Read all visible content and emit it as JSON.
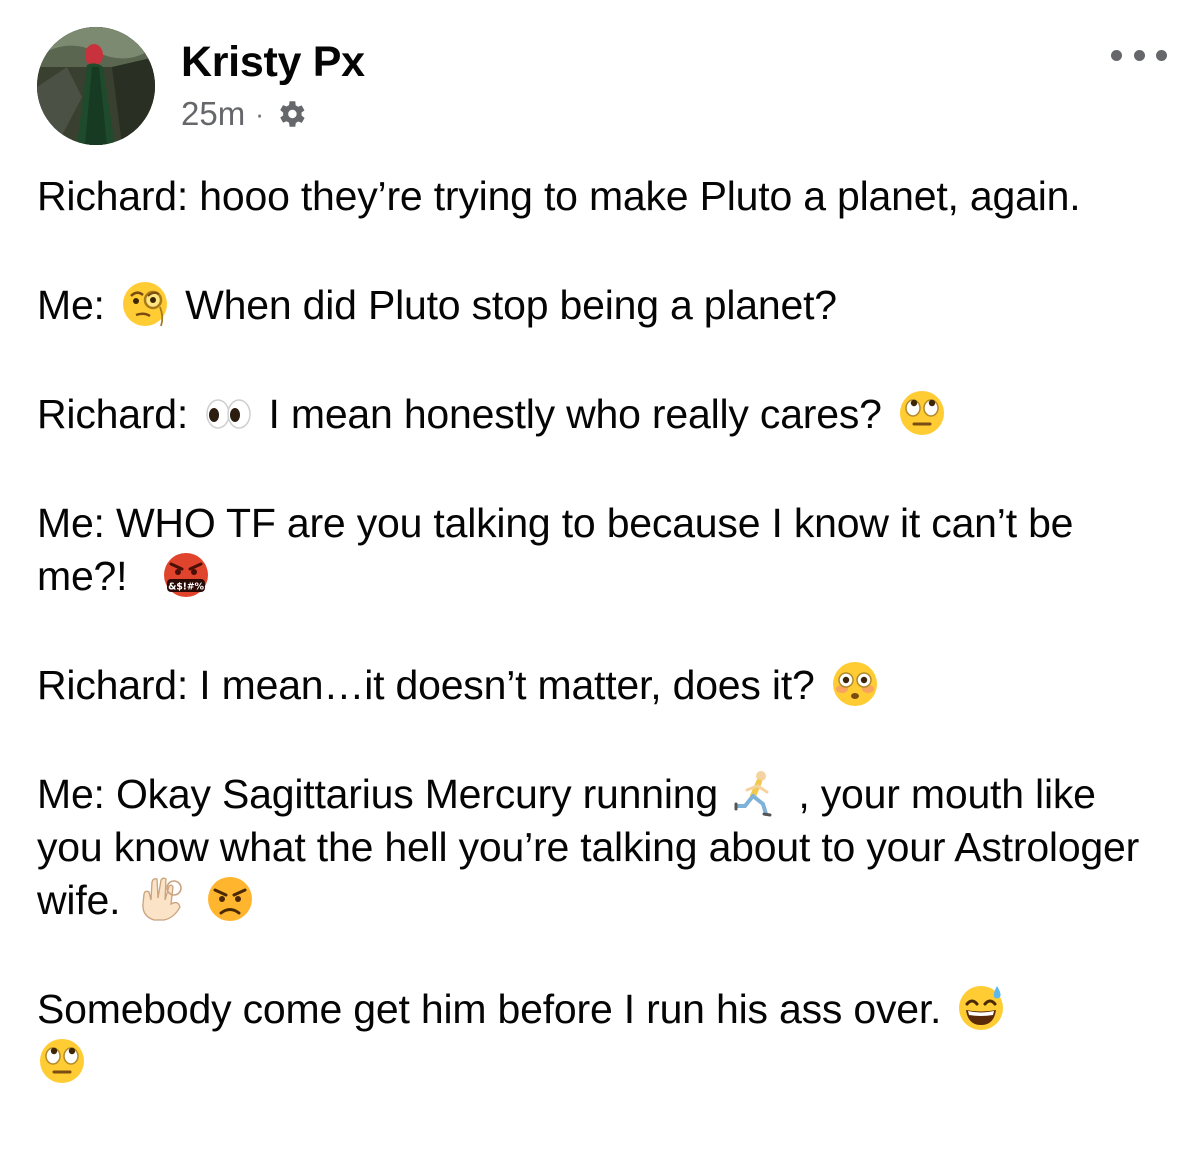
{
  "post": {
    "author": "Kristy Px",
    "timestamp": "25m",
    "separator": "·",
    "privacy_icon": "gear-icon",
    "menu_icon": "more-options-icon",
    "avatar": "profile-photo"
  },
  "content": {
    "p1": "Richard: hooo they’re trying to make Pluto a planet, again.",
    "p2_speaker": "Me:",
    "p2_text": "When did Pluto stop being a planet?",
    "p3_speaker": "Richard:",
    "p3_text": "I mean honestly who really cares?",
    "p4_text": "Me: WHO TF are you talking to because I know it can’t be me?!",
    "p5_text": "Richard: I mean…it doesn’t matter, does it?",
    "p6_text_a": "Me: Okay Sagittarius Mercury running",
    "p6_text_b": ", your mouth like you know what the hell you’re talking about to your Astrologer wife.",
    "p7_text": "Somebody come get him before I run his ass over."
  },
  "emojis": {
    "monocle": "face-with-monocle-emoji",
    "eyes": "eyes-emoji",
    "rolling_eyes": "face-with-rolling-eyes-emoji",
    "cursing": "face-with-symbols-on-mouth-emoji",
    "cursing_symbols": "&$!#%",
    "flushed": "flushed-face-emoji",
    "runner": "person-running-emoji",
    "ok_hand": "ok-hand-emoji",
    "angry": "angry-face-emoji",
    "sweat_smile": "grinning-face-with-sweat-emoji"
  },
  "colors": {
    "text": "#050505",
    "secondary": "#65676b",
    "emoji_yellow": "#ffcc33",
    "emoji_red": "#e0442c"
  }
}
